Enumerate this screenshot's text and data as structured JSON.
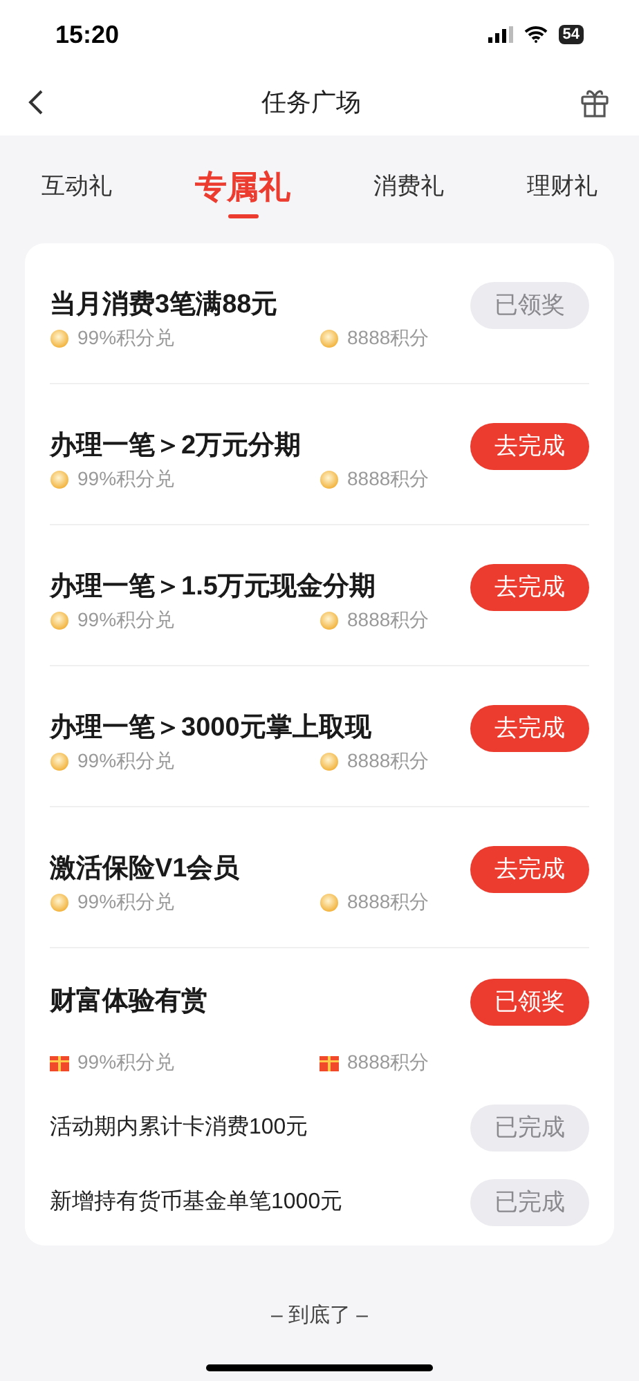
{
  "status_bar": {
    "time": "15:20",
    "battery": "54"
  },
  "nav": {
    "title": "任务广场"
  },
  "tabs": [
    {
      "label": "互动礼",
      "selected": false
    },
    {
      "label": "专属礼",
      "selected": true
    },
    {
      "label": "消费礼",
      "selected": false
    },
    {
      "label": "理财礼",
      "selected": false
    }
  ],
  "tasks": [
    {
      "title": "当月消费3笔满88元",
      "kind": "coin",
      "rewards": [
        "99%积分兑",
        "8888积分"
      ],
      "button": {
        "label": "已领奖",
        "highlighted": false
      }
    },
    {
      "title": "办理一笔＞2万元分期",
      "kind": "coin",
      "rewards": [
        "99%积分兑",
        "8888积分"
      ],
      "button": {
        "label": "去完成",
        "highlighted": true
      }
    },
    {
      "title": "办理一笔＞1.5万元现金分期",
      "kind": "coin",
      "rewards": [
        "99%积分兑",
        "8888积分"
      ],
      "button": {
        "label": "去完成",
        "highlighted": true
      }
    },
    {
      "title": "办理一笔＞3000元掌上取现",
      "kind": "coin",
      "rewards": [
        "99%积分兑",
        "8888积分"
      ],
      "button": {
        "label": "去完成",
        "highlighted": true
      }
    },
    {
      "title": "激活保险V1会员",
      "kind": "coin",
      "rewards": [
        "99%积分兑",
        "8888积分"
      ],
      "button": {
        "label": "去完成",
        "highlighted": true
      }
    },
    {
      "title": "财富体验有赏",
      "kind": "gift",
      "rewards": [
        "99%积分兑",
        "8888积分"
      ],
      "button": {
        "label": "已领奖",
        "highlighted": true
      },
      "subtasks": [
        {
          "label": "活动期内累计卡消费100元",
          "button": {
            "label": "已完成",
            "highlighted": false
          }
        },
        {
          "label": "新增持有货币基金单笔1000元",
          "button": {
            "label": "已完成",
            "highlighted": false
          }
        }
      ]
    }
  ],
  "footer": "– 到底了 –"
}
